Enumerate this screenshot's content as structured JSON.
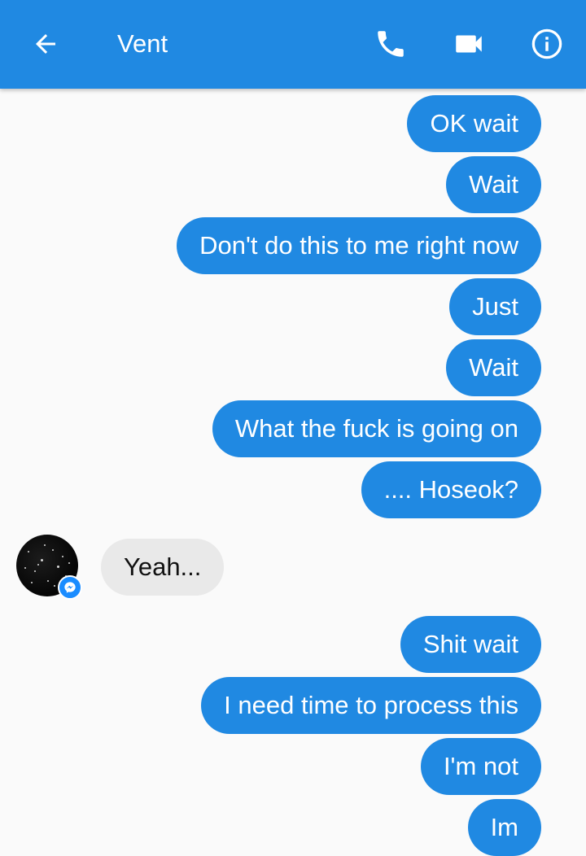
{
  "header": {
    "title": "Vent",
    "back_icon": "arrow-left-icon",
    "call_icon": "phone-icon",
    "video_icon": "video-camera-icon",
    "info_icon": "info-icon"
  },
  "colors": {
    "accent": "#2089e2",
    "incoming_bubble": "#e9e9e9",
    "background": "#fafafa"
  },
  "messages": [
    {
      "direction": "out",
      "text": "OK wait"
    },
    {
      "direction": "out",
      "text": "Wait"
    },
    {
      "direction": "out",
      "text": "Don't do this to me right now"
    },
    {
      "direction": "out",
      "text": "Just"
    },
    {
      "direction": "out",
      "text": "Wait"
    },
    {
      "direction": "out",
      "text": "What the fuck is going on"
    },
    {
      "direction": "out",
      "text": ".... Hoseok?"
    },
    {
      "direction": "in",
      "text": "Yeah..."
    },
    {
      "direction": "out",
      "text": "Shit wait"
    },
    {
      "direction": "out",
      "text": "I need time to process this"
    },
    {
      "direction": "out",
      "text": "I'm not"
    },
    {
      "direction": "out",
      "text": "Im"
    }
  ]
}
